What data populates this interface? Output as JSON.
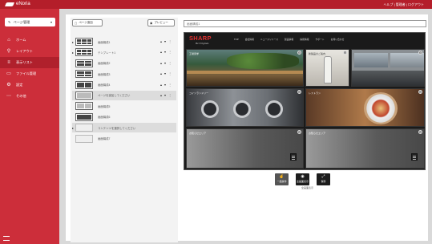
{
  "app": {
    "title": "eNoria",
    "user": "ヘルプ | 管理者 | ログアウト"
  },
  "sidebar": {
    "mode_button": "ページ管理",
    "items": [
      {
        "label": "ホーム",
        "icon": "home-icon"
      },
      {
        "label": "レイアウト",
        "icon": "pin-icon"
      },
      {
        "label": "表示リスト",
        "icon": "list-icon"
      },
      {
        "label": "ファイル管理",
        "icon": "folder-icon"
      },
      {
        "label": "設定",
        "icon": "gear-icon"
      },
      {
        "label": "その他",
        "icon": "more-icon"
      }
    ]
  },
  "left_panel": {
    "add_button": "ページ追加",
    "preview_button": "プレビュー",
    "rows": [
      {
        "label": "画面構成1"
      },
      {
        "label": "テンプレート1"
      },
      {
        "label": "画面構成2"
      },
      {
        "label": "画面構成3"
      },
      {
        "label": "画面構成4"
      },
      {
        "label": "ページを追加してください"
      },
      {
        "label": "画面構成5"
      },
      {
        "label": "画面構成6"
      },
      {
        "label": "コンテンツを選択してください"
      },
      {
        "label": "画面構成7"
      }
    ]
  },
  "search": {
    "placeholder": "画面構成1"
  },
  "preview": {
    "brand": "SHARP",
    "tagline": "Be Original.",
    "nav": [
      "TOP",
      "会社情報",
      "ニュースリリース",
      "製品情報",
      "採用情報",
      "サポート",
      "お問い合わせ"
    ],
    "tiles": [
      "工場見学",
      "新製品のご案内",
      "",
      "コインランドリー",
      "レストラン",
      "",
      "お知らせエリア",
      "お知らせエリア"
    ]
  },
  "actions": {
    "buttons": [
      {
        "label": "一括操作"
      },
      {
        "label": "全画面表示"
      },
      {
        "label": "保存"
      }
    ],
    "note": "全画面表示"
  }
}
